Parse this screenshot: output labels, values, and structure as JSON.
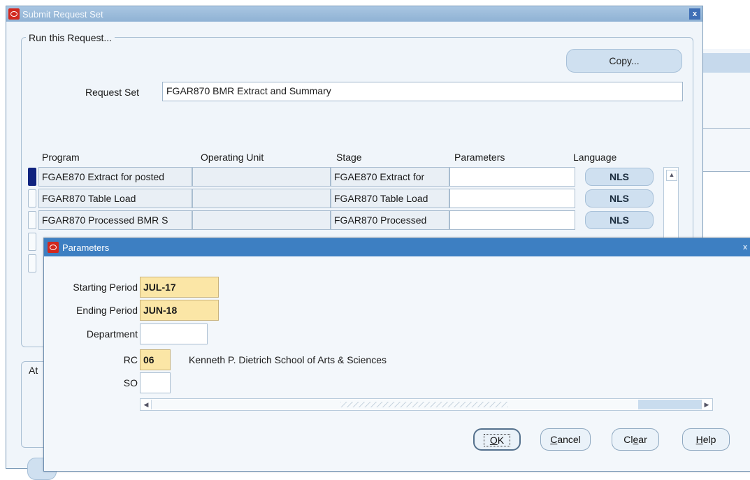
{
  "submit_window": {
    "title": "Submit Request Set",
    "close_label": "x",
    "group_title": "Run this Request...",
    "copy_button": "Copy...",
    "request_set_label": "Request Set",
    "request_set_value": "FGAR870 BMR Extract and Summary",
    "columns": [
      "Program",
      "Operating Unit",
      "Stage",
      "Parameters",
      "Language"
    ],
    "rows": [
      {
        "program": "FGAE870 Extract for posted",
        "operating_unit": "",
        "stage": "FGAE870 Extract for",
        "parameters": "",
        "language": "NLS"
      },
      {
        "program": "FGAR870 Table Load",
        "operating_unit": "",
        "stage": "FGAR870 Table Load",
        "parameters": "",
        "language": "NLS"
      },
      {
        "program": "FGAR870 Processed BMR S",
        "operating_unit": "",
        "stage": "FGAR870 Processed",
        "parameters": "",
        "language": "NLS"
      }
    ],
    "at_label": "At"
  },
  "parameters_dialog": {
    "title": "Parameters",
    "close_label": "x",
    "fields": {
      "starting_period": {
        "label": "Starting Period",
        "value": "JUL-17"
      },
      "ending_period": {
        "label": "Ending Period",
        "value": "JUN-18"
      },
      "department": {
        "label": "Department",
        "value": ""
      },
      "rc": {
        "label": "RC",
        "value": "06",
        "description": "Kenneth P. Dietrich School of Arts & Sciences"
      },
      "so": {
        "label": "SO",
        "value": ""
      }
    },
    "buttons": {
      "ok": {
        "mnemonic": "O",
        "rest": "K"
      },
      "cancel": {
        "mnemonic": "C",
        "rest": "ancel"
      },
      "clear": {
        "pre": "Cl",
        "mnemonic": "e",
        "rest": "ar"
      },
      "help": {
        "mnemonic": "H",
        "rest": "elp"
      }
    }
  }
}
